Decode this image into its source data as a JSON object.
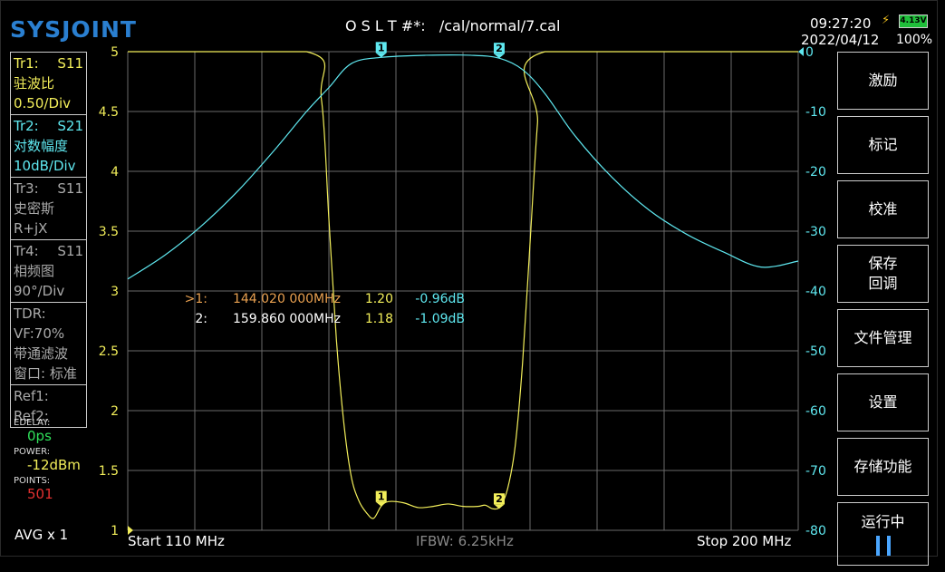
{
  "header": {
    "logo": "SYSJOINT",
    "cal": "O S L T #*:   /cal/normal/7.cal",
    "time": "09:27:20",
    "date": "2022/04/12",
    "battery_voltage": "4.13V",
    "battery_percent": "100%"
  },
  "traces": [
    {
      "l1": "Tr1:",
      "r1": "S11",
      "l2": "驻波比",
      "l3": "0.50/Div",
      "color": "#f2ee5a"
    },
    {
      "l1": "Tr2:",
      "r1": "S21",
      "l2": "对数幅度",
      "l3": "10dB/Div",
      "color": "#5fe8f0"
    },
    {
      "l1": "Tr3:",
      "r1": "S11",
      "l2": "史密斯",
      "l3": "R+jX",
      "color": "#aaaaaa"
    },
    {
      "l1": "Tr4:",
      "r1": "S11",
      "l2": "相频图",
      "l3": "90°/Div",
      "color": "#aaaaaa"
    }
  ],
  "tdr": {
    "l1": "TDR:",
    "l2": "VF:70%",
    "l3": "带通滤波",
    "l4": "窗口: 标准"
  },
  "refs": {
    "ref1": "Ref1:",
    "ref2": "Ref2:"
  },
  "stats": {
    "edelay_label": "EDELAY:",
    "edelay_value": "0ps",
    "power_label": "POWER:",
    "power_value": "-12dBm",
    "points_label": "POINTS:",
    "points_value": "501"
  },
  "avg": "AVG x 1",
  "softkeys": {
    "k1": "激励",
    "k2": "标记",
    "k3": "校准",
    "k4a": "保存",
    "k4b": "回调",
    "k5": "文件管理",
    "k6": "设置",
    "k7": "存储功能",
    "k8": "运行中"
  },
  "bottom": {
    "start": "Start   110 MHz",
    "ifbw": "IFBW: 6.25kHz",
    "stop": "Stop   200 MHz"
  },
  "markers": [
    {
      "prefix": ">1:",
      "freq": "144.020 000MHz",
      "vswr": "1.20",
      "db": "-0.96dB"
    },
    {
      "prefix": "2:",
      "freq": "159.860 000MHz",
      "vswr": "1.18",
      "db": "-1.09dB"
    }
  ],
  "chart_data": {
    "type": "line",
    "x_range": [
      110,
      200
    ],
    "left_axis": {
      "ticks": [
        "5",
        "4.5",
        "4",
        "3.5",
        "3",
        "2.5",
        "2",
        "1.5",
        "1"
      ],
      "range": [
        1,
        5
      ]
    },
    "right_axis": {
      "ticks": [
        "0",
        "-10",
        "-20",
        "-30",
        "-40",
        "-50",
        "-60",
        "-70",
        "-80"
      ],
      "range": [
        -80,
        0
      ]
    },
    "grid": true,
    "series": [
      {
        "color": "#f2ee5a",
        "axis": "left",
        "x": [
          110,
          134,
          136,
          137,
          138,
          139,
          140,
          141,
          142,
          143,
          144,
          145,
          147,
          149,
          151,
          153,
          155,
          157,
          158,
          159,
          160,
          161,
          162,
          163,
          164,
          165,
          166,
          200
        ],
        "y": [
          5,
          5,
          4.6,
          3.6,
          2.6,
          1.9,
          1.45,
          1.25,
          1.15,
          1.1,
          1.2,
          1.24,
          1.23,
          1.19,
          1.2,
          1.22,
          1.2,
          1.2,
          1.21,
          1.18,
          1.2,
          1.35,
          1.7,
          2.4,
          3.4,
          4.4,
          5,
          5
        ]
      },
      {
        "color": "#5fe8f0",
        "axis": "right",
        "x": [
          110,
          115,
          120,
          125,
          130,
          134,
          137,
          140,
          144,
          150,
          156,
          159.86,
          163,
          166,
          170,
          175,
          180,
          185,
          190,
          195,
          200
        ],
        "y": [
          -38,
          -34,
          -29,
          -23,
          -16,
          -10,
          -6,
          -2,
          -0.96,
          -0.6,
          -0.6,
          -1.09,
          -3,
          -7,
          -14,
          -21,
          -26.5,
          -30.5,
          -33.5,
          -36,
          -35
        ]
      }
    ],
    "chart_markers": [
      {
        "label": "1",
        "x": 144.02,
        "s11": 1.2,
        "s21": -0.96
      },
      {
        "label": "2",
        "x": 159.86,
        "s11": 1.18,
        "s21": -1.09
      }
    ]
  }
}
